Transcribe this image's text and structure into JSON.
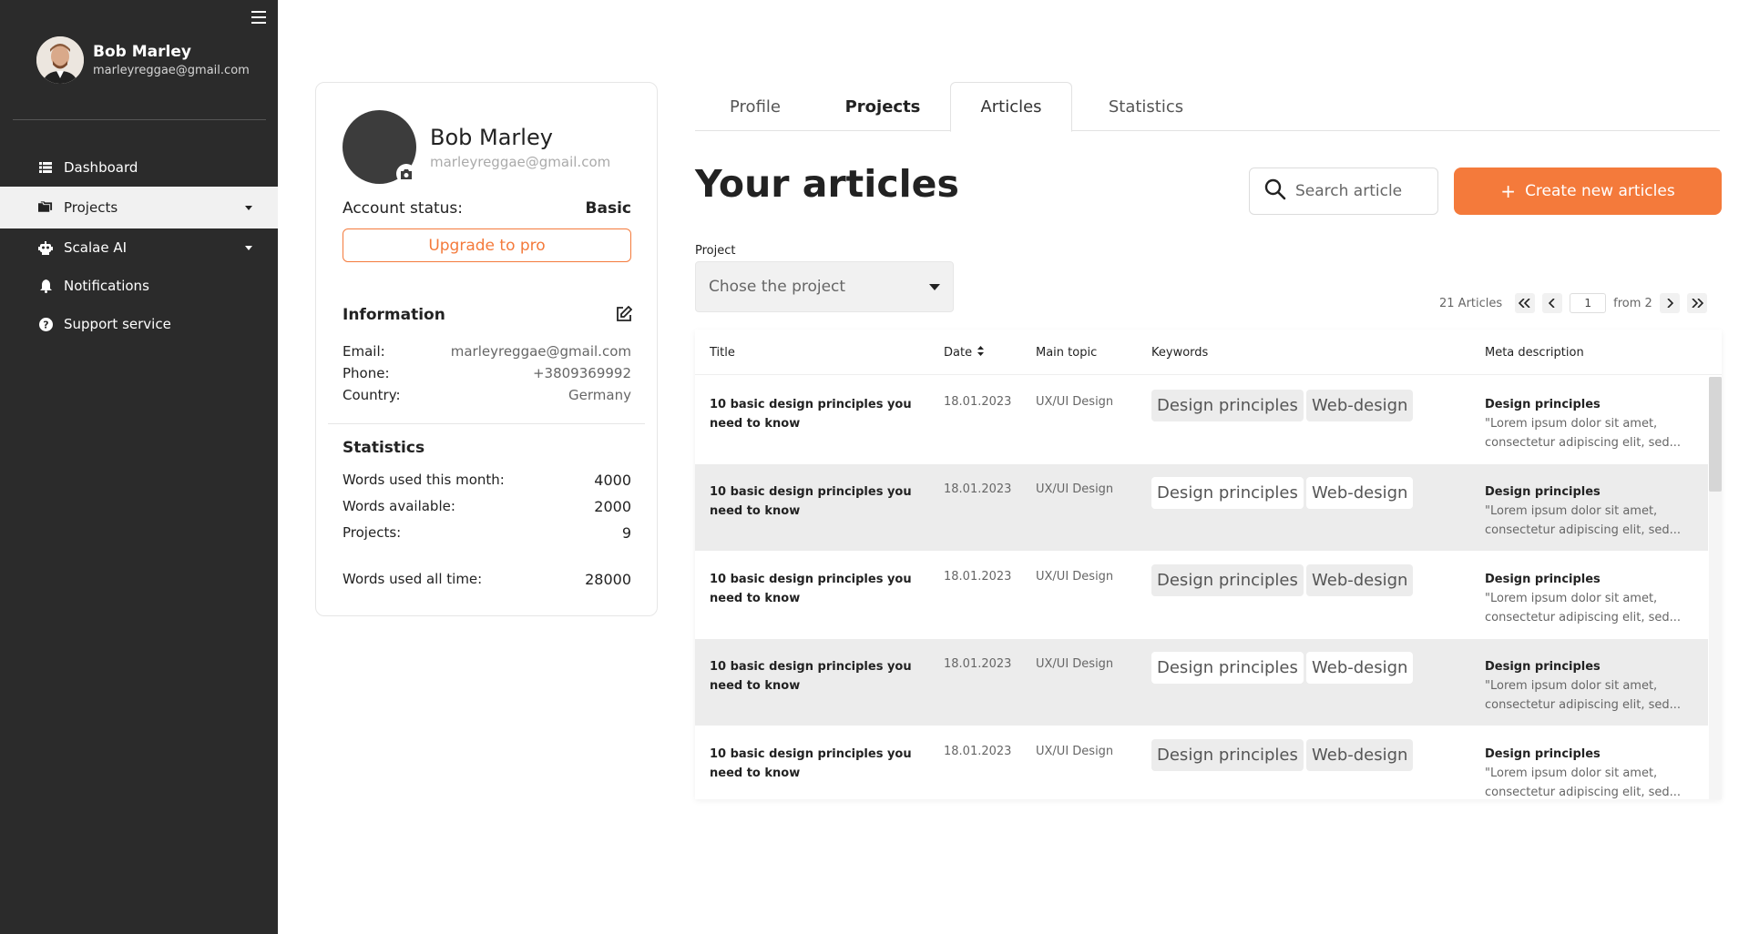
{
  "sidebar": {
    "user": {
      "name": "Bob Marley",
      "email": "marleyreggae@gmail.com"
    },
    "items": [
      {
        "label": "Dashboard",
        "icon": "list-icon"
      },
      {
        "label": "Projects",
        "icon": "folder-icon",
        "active": true,
        "has_caret": true
      },
      {
        "label": "Scalae AI",
        "icon": "robot-icon",
        "has_caret": true
      },
      {
        "label": "Notifications",
        "icon": "bell-icon"
      },
      {
        "label": "Support service",
        "icon": "help-icon"
      }
    ]
  },
  "profile": {
    "name": "Bob Marley",
    "email": "marleyreggae@gmail.com",
    "status_label": "Account status:",
    "status_value": "Basic",
    "upgrade_label": "Upgrade to pro",
    "info_title": "Information",
    "info": [
      {
        "k": "Email:",
        "v": "marleyreggae@gmail.com"
      },
      {
        "k": "Phone:",
        "v": "+3809369992"
      },
      {
        "k": "Country:",
        "v": "Germany"
      }
    ],
    "stats_title": "Statistics",
    "stats": [
      {
        "k": "Words used this month:",
        "v": "4000"
      },
      {
        "k": "Words available:",
        "v": "2000"
      },
      {
        "k": "Projects:",
        "v": "9"
      },
      {
        "k": "Words used all time:",
        "v": "28000"
      }
    ]
  },
  "tabs": [
    "Profile",
    "Projects",
    "Articles",
    "Statistics"
  ],
  "main": {
    "title": "Your articles",
    "search_placeholder": "Search article",
    "create_label": "Create new articles",
    "project_label": "Project",
    "project_placeholder": "Chose the project",
    "pager": {
      "count": "21 Articles",
      "page": "1",
      "from": "from 2"
    }
  },
  "table": {
    "headers": {
      "title": "Title",
      "date": "Date",
      "topic": "Main topic",
      "keywords": "Keywords",
      "meta": "Meta description"
    },
    "rows": [
      {
        "title": "10 basic design principles you need to know",
        "date": "18.01.2023",
        "topic": "UX/UI Design",
        "tags": [
          "Design principles",
          "Web-design"
        ],
        "meta_title": "Design principles",
        "meta_text": "\"Lorem ipsum dolor sit amet, consectetur adipiscing elit, sed..."
      },
      {
        "title": "10 basic design principles you need to know",
        "date": "18.01.2023",
        "topic": "UX/UI Design",
        "tags": [
          "Design principles",
          "Web-design"
        ],
        "meta_title": "Design principles",
        "meta_text": "\"Lorem ipsum dolor sit amet, consectetur adipiscing elit, sed..."
      },
      {
        "title": "10 basic design principles you need to know",
        "date": "18.01.2023",
        "topic": "UX/UI Design",
        "tags": [
          "Design principles",
          "Web-design"
        ],
        "meta_title": "Design principles",
        "meta_text": "\"Lorem ipsum dolor sit amet, consectetur adipiscing elit, sed..."
      },
      {
        "title": "10 basic design principles you need to know",
        "date": "18.01.2023",
        "topic": "UX/UI Design",
        "tags": [
          "Design principles",
          "Web-design"
        ],
        "meta_title": "Design principles",
        "meta_text": "\"Lorem ipsum dolor sit amet, consectetur adipiscing elit, sed..."
      },
      {
        "title": "10 basic design principles you need to know",
        "date": "18.01.2023",
        "topic": "UX/UI Design",
        "tags": [
          "Design principles",
          "Web-design"
        ],
        "meta_title": "Design principles",
        "meta_text": "\"Lorem ipsum dolor sit amet, consectetur adipiscing elit, sed..."
      }
    ]
  },
  "colors": {
    "accent": "#f47a3b",
    "sidebar_bg": "#2b2b2b",
    "row_alt": "#ececec"
  }
}
